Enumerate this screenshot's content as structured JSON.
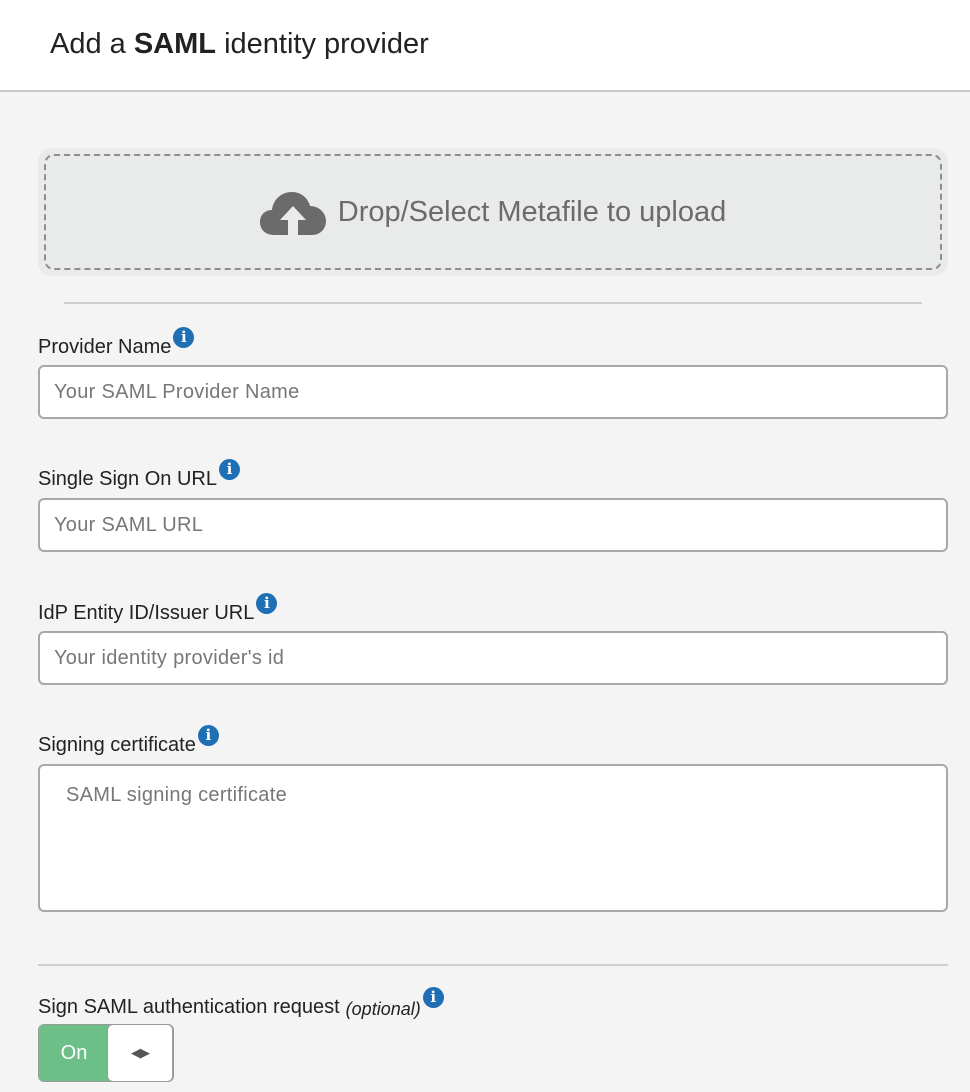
{
  "header": {
    "title_prefix": "Add a ",
    "title_bold": "SAML",
    "title_suffix": " identity provider"
  },
  "upload": {
    "icon": "cloud-upload-icon",
    "label": "Drop/Select Metafile to upload"
  },
  "fields": {
    "provider_name": {
      "label": "Provider Name",
      "placeholder": "Your SAML Provider Name",
      "value": ""
    },
    "sso_url": {
      "label": "Single Sign On URL",
      "placeholder": "Your SAML URL",
      "value": ""
    },
    "entity_id": {
      "label": "IdP Entity ID/Issuer URL",
      "placeholder": "Your identity provider's id",
      "value": ""
    },
    "certificate": {
      "label": "Signing certificate",
      "placeholder": "SAML signing certificate",
      "value": ""
    }
  },
  "sign_request": {
    "label": "Sign SAML authentication request",
    "optional": "(optional)",
    "toggle_label": "On",
    "toggle_state": "on"
  },
  "icons": {
    "info": "i"
  },
  "colors": {
    "info_icon": "#1f6fb5",
    "toggle_on": "#6cbf86",
    "background": "#f4f4f4"
  }
}
